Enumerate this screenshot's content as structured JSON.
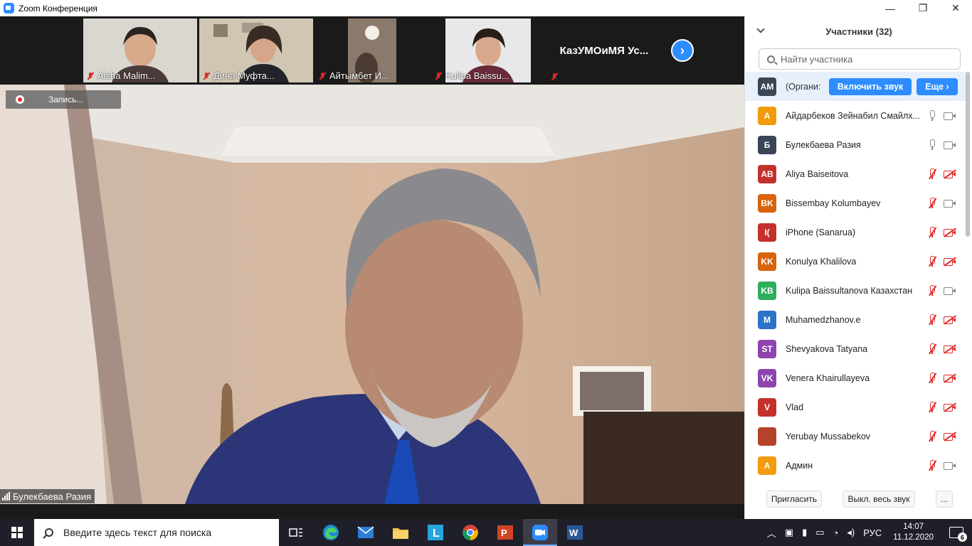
{
  "window": {
    "title": "Zoom Конференция",
    "minimize": "—",
    "restore": "❐",
    "close": "✕"
  },
  "thumbnails": [
    {
      "name": "Aisha Malim...",
      "muted": true
    },
    {
      "name": "Дина Муфта...",
      "muted": true
    },
    {
      "name": "Айтымбет И...",
      "muted": true
    },
    {
      "name": "Kulipa Baissu...",
      "muted": true
    },
    {
      "name": "КазУМОиМЯ  Ус...",
      "muted": true
    }
  ],
  "next_label": "›",
  "recording_label": "Запись...",
  "active_speaker": "Булекбаева Разия",
  "panel": {
    "title": "Участники (32)",
    "search_placeholder": "Найти участника",
    "host": {
      "initials": "AM",
      "name": "(Органи:",
      "unmute_label": "Включить звук",
      "more_label": "Еще ›",
      "color": "#3a4556"
    },
    "participants": [
      {
        "initials": "A",
        "name": "Айдарбеков Зейнабил Смайлх...",
        "color": "#f29b0c",
        "mic_muted": false,
        "cam_off": false
      },
      {
        "initials": "Б",
        "name": "Булекбаева Разия",
        "color": "#3a4556",
        "mic_muted": false,
        "cam_off": false
      },
      {
        "initials": "AB",
        "name": "Aliya Baiseitova",
        "color": "#c4302b",
        "mic_muted": true,
        "cam_off": true
      },
      {
        "initials": "BK",
        "name": "Bissembay Kolumbayev",
        "color": "#d9630c",
        "mic_muted": true,
        "cam_off": false
      },
      {
        "initials": "I(",
        "name": "iPhone (Sanarua)",
        "color": "#c4302b",
        "mic_muted": true,
        "cam_off": true
      },
      {
        "initials": "KK",
        "name": "Konulya Khalilova",
        "color": "#d9630c",
        "mic_muted": true,
        "cam_off": true
      },
      {
        "initials": "KB",
        "name": "Kulipa Baissultanova Казахстан",
        "color": "#2fae5c",
        "mic_muted": true,
        "cam_off": false
      },
      {
        "initials": "M",
        "name": "Muhamedzhanov.e",
        "color": "#2a73c8",
        "mic_muted": true,
        "cam_off": true
      },
      {
        "initials": "ST",
        "name": "Shevyakova Tatyana",
        "color": "#8e44ad",
        "mic_muted": true,
        "cam_off": true
      },
      {
        "initials": "VK",
        "name": "Venera Khairullayeva",
        "color": "#8e44ad",
        "mic_muted": true,
        "cam_off": true
      },
      {
        "initials": "V",
        "name": "Vlad",
        "color": "#c4302b",
        "mic_muted": true,
        "cam_off": true
      },
      {
        "initials": "",
        "name": "Yerubay Mussabekov",
        "color": "#b5432a",
        "mic_muted": true,
        "cam_off": true
      },
      {
        "initials": "A",
        "name": "Админ",
        "color": "#f29b0c",
        "mic_muted": true,
        "cam_off": false
      }
    ],
    "footer": {
      "invite": "Пригласить",
      "mute_all": "Выкл. весь звук",
      "more": "..."
    }
  },
  "taskbar": {
    "search_placeholder": "Введите здесь текст для поиска",
    "apps": [
      "task-view",
      "edge",
      "mail",
      "file-explorer",
      "lingualeo",
      "chrome",
      "powerpoint",
      "zoom",
      "word"
    ],
    "lang": "РУС",
    "time": "14:07",
    "date": "11.12.2020",
    "notifications": "6"
  }
}
